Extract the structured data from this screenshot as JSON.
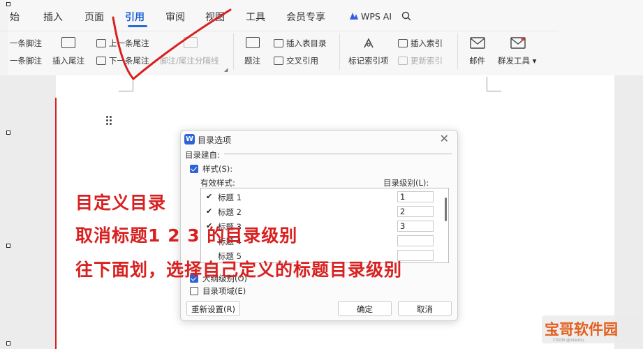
{
  "tabs": [
    {
      "label": "始",
      "active": false
    },
    {
      "label": "插入",
      "active": false
    },
    {
      "label": "页面",
      "active": false
    },
    {
      "label": "引用",
      "active": true
    },
    {
      "label": "审阅",
      "active": false
    },
    {
      "label": "视图",
      "active": false
    },
    {
      "label": "工具",
      "active": false
    },
    {
      "label": "会员专享",
      "active": false
    },
    {
      "label": "WPS AI",
      "active": false
    }
  ],
  "ribbon": {
    "footnote_prev": "一条脚注",
    "footnote_next": "一条脚注",
    "insert_endnote": "插入尾注",
    "prev_endnote": "上一条尾注",
    "next_endnote": "下一条尾注",
    "separator_label": "脚注/尾注分隔线",
    "caption": "题注",
    "insert_table_of_figures": "插入表目录",
    "cross_reference": "交叉引用",
    "mark_index_entry": "标记索引项",
    "insert_index": "插入索引",
    "update_index": "更新索引",
    "mail": "邮件",
    "mass_send": "群发工具"
  },
  "dialog": {
    "title": "目录选项",
    "build_from": "目录建自:",
    "styles_label": "样式(S):",
    "available_styles": "有效样式:",
    "toc_level": "目录级别(L):",
    "rows": [
      {
        "name": "标题 1",
        "checked": true,
        "level": "1"
      },
      {
        "name": "标题 2",
        "checked": true,
        "level": "2"
      },
      {
        "name": "标题 3",
        "checked": true,
        "level": "3"
      },
      {
        "name": "标题 4",
        "checked": false,
        "level": ""
      },
      {
        "name": "标题 5",
        "checked": false,
        "level": ""
      }
    ],
    "outline_level": "大纲级别(O)",
    "toc_fields": "目录项域(E)",
    "reset": "重新设置(R)",
    "ok": "确定",
    "cancel": "取消"
  },
  "annotations": [
    "目定义目录",
    "取消标题1 2 3 的目录级别",
    "往下面划，选择自己定义的标题目录级别"
  ],
  "watermark": {
    "title": "宝哥软件园",
    "sub": "CSDN @xiaoliu"
  },
  "colors": {
    "accent": "#1f5fd6",
    "annotation": "#d92020",
    "watermark": "#e45f1e"
  }
}
